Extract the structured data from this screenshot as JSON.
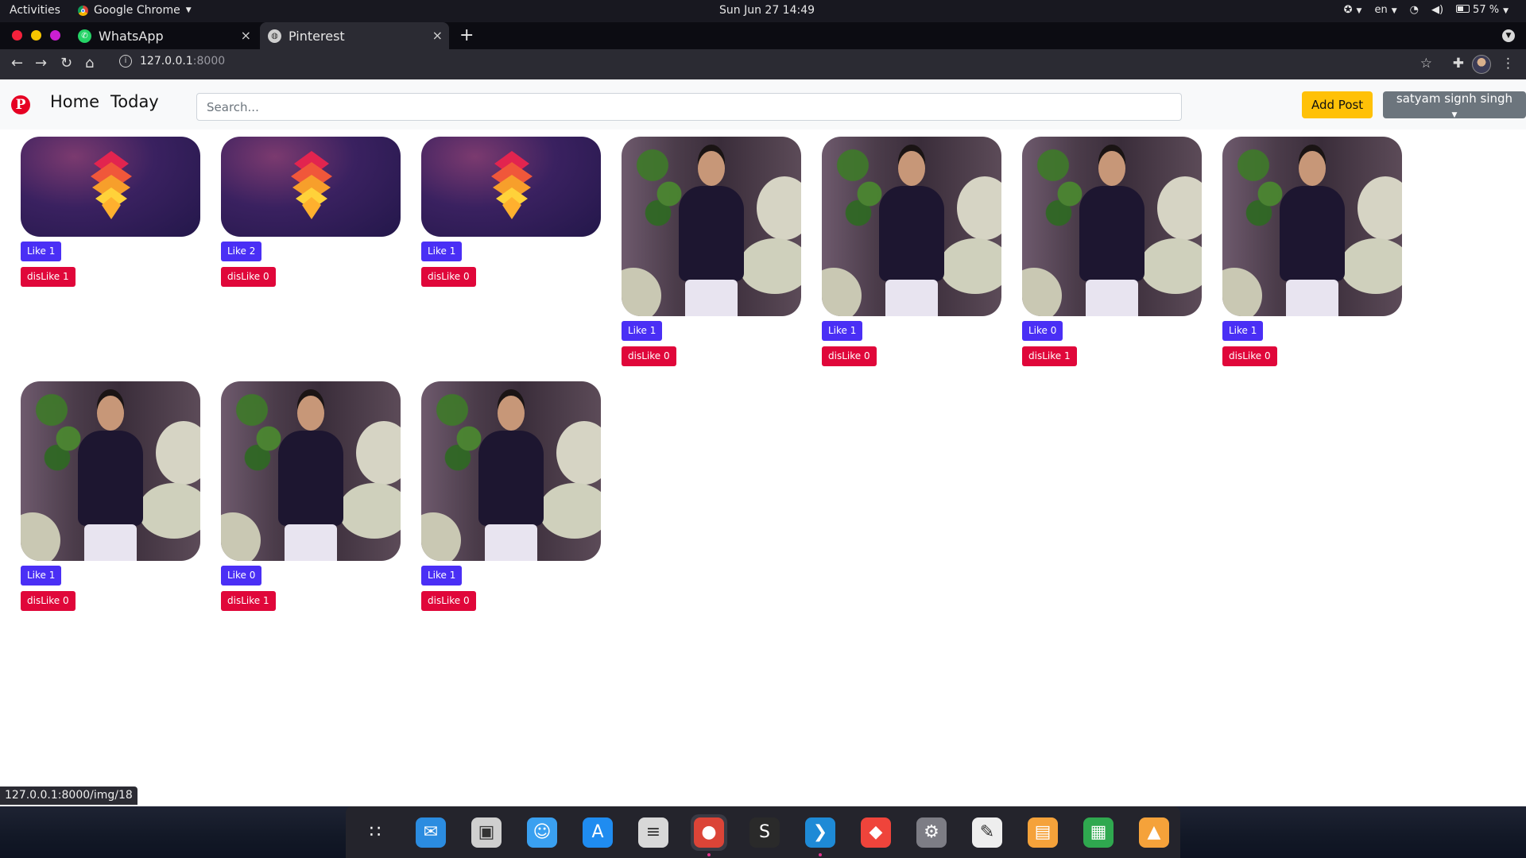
{
  "system_bar": {
    "activities": "Activities",
    "app_menu": "Google Chrome",
    "clock": "Sun Jun 27  14:49",
    "language": "en‎",
    "battery": "57 %"
  },
  "tabs": [
    {
      "title": "WhatsApp",
      "favicon": "whatsapp-icon",
      "color": "#25d366"
    },
    {
      "title": "Pinterest",
      "favicon": "globe-icon",
      "color": "#d0d0d0"
    }
  ],
  "address_bar": {
    "host": "127.0.0.1",
    "port": ":8000"
  },
  "navbar": {
    "brand_glyph": "P",
    "links": [
      "Home",
      "Today"
    ],
    "search_placeholder": "Search...",
    "add_post": "Add Post",
    "user": "satyam signh singh"
  },
  "posts": [
    {
      "image": "logo",
      "like": "Like 1",
      "dislike": "disLike 1"
    },
    {
      "image": "logo",
      "like": "Like 2",
      "dislike": "disLike 0"
    },
    {
      "image": "logo",
      "like": "Like 1",
      "dislike": "disLike 0"
    },
    {
      "image": "person",
      "like": "Like 1",
      "dislike": "disLike 0"
    },
    {
      "image": "person",
      "like": "Like 1",
      "dislike": "disLike 0"
    },
    {
      "image": "person",
      "like": "Like 0",
      "dislike": "disLike 1"
    },
    {
      "image": "person",
      "like": "Like 1",
      "dislike": "disLike 0"
    },
    {
      "image": "person",
      "like": "Like 1",
      "dislike": "disLike 0"
    },
    {
      "image": "person",
      "like": "Like 0",
      "dislike": "disLike 1"
    },
    {
      "image": "person",
      "like": "Like 1",
      "dislike": "disLike 0"
    }
  ],
  "status_url": "127.0.0.1:8000/img/18",
  "dock": [
    {
      "name": "app-grid-icon",
      "glyph": "∷"
    },
    {
      "name": "mail-icon",
      "glyph": "✉"
    },
    {
      "name": "screenshot-icon",
      "glyph": "▣"
    },
    {
      "name": "finder-icon",
      "glyph": "☺"
    },
    {
      "name": "app-store-icon",
      "glyph": "A"
    },
    {
      "name": "calculator-icon",
      "glyph": "≡"
    },
    {
      "name": "chrome-icon",
      "glyph": "●"
    },
    {
      "name": "sublime-icon",
      "glyph": "S"
    },
    {
      "name": "vscode-icon",
      "glyph": "❯"
    },
    {
      "name": "anydesk-icon",
      "glyph": "◆"
    },
    {
      "name": "settings-icon",
      "glyph": "⚙"
    },
    {
      "name": "text-editor-icon",
      "glyph": "✎"
    },
    {
      "name": "presentation-icon",
      "glyph": "▤"
    },
    {
      "name": "spreadsheet-icon",
      "glyph": "▦"
    },
    {
      "name": "image-viewer-icon",
      "glyph": "▲"
    }
  ]
}
